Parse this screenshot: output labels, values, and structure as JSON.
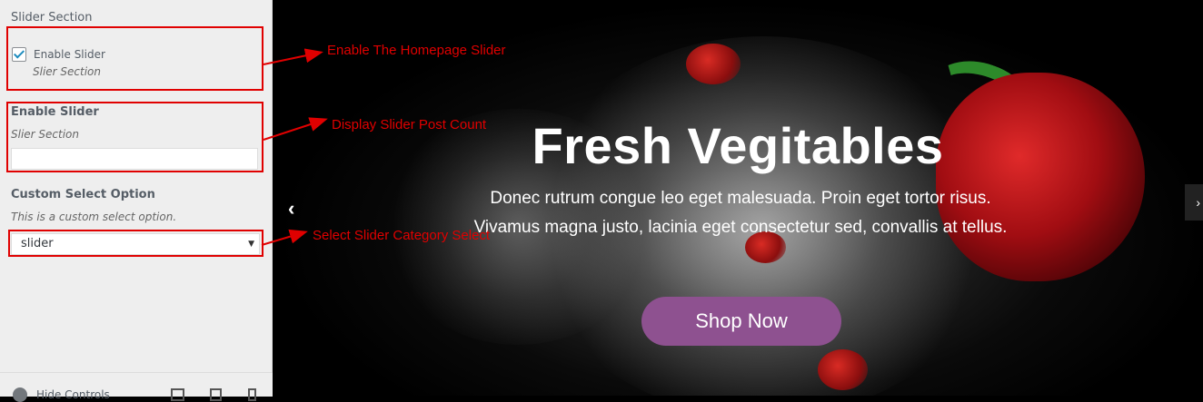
{
  "sidebar": {
    "section_title": "Slider Section",
    "enable_checkbox": {
      "label": "Enable Slider",
      "description": "Slier Section",
      "checked": true
    },
    "count_control": {
      "title": "Enable Slider",
      "description": "Slier Section",
      "value": ""
    },
    "select_control": {
      "title": "Custom Select Option",
      "description": "This is a custom select option.",
      "selected": "slider"
    },
    "footer": {
      "hide_controls_label": "Hide Controls"
    }
  },
  "slide": {
    "title": "Fresh Vegitables",
    "text": "Donec rutrum congue leo eget malesuada. Proin eget tortor risus. Vivamus magna justo, lacinia eget consectetur sed, convallis at tellus.",
    "button_label": "Shop Now",
    "prev_label": "‹",
    "next_label": "›"
  },
  "annotations": {
    "enable_slider": "Enable The Homepage Slider",
    "post_count": "Display Slider Post Count",
    "category_select": "Select Slider Category Select"
  },
  "colors": {
    "annotation_red": "#e00000",
    "button_purple": "#8e5190",
    "sidebar_bg": "#eeeeee",
    "checkbox_blue": "#1e8cbe"
  }
}
